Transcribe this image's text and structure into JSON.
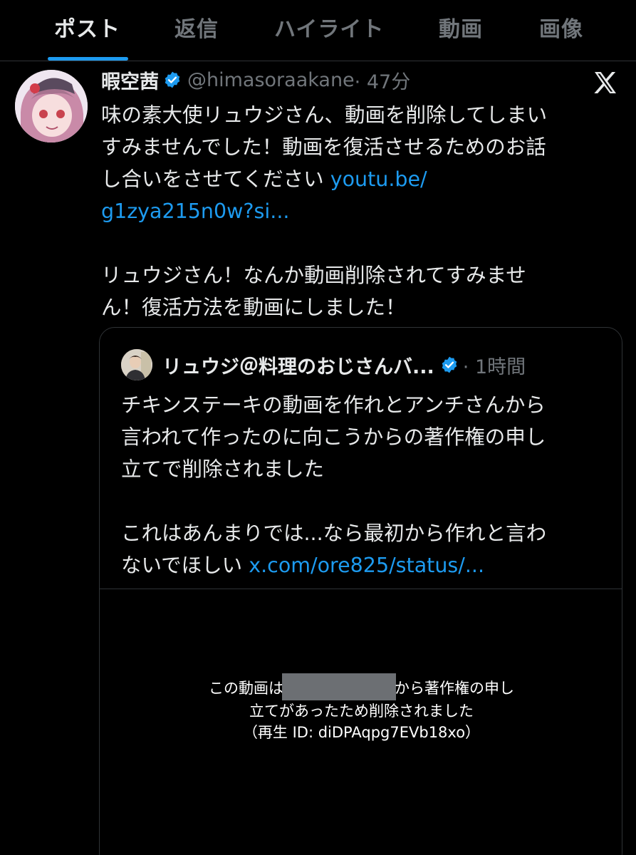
{
  "tabs": [
    {
      "label": "ポスト",
      "active": true
    },
    {
      "label": "返信",
      "active": false
    },
    {
      "label": "ハイライト",
      "active": false
    },
    {
      "label": "動画",
      "active": false
    },
    {
      "label": "画像",
      "active": false
    }
  ],
  "post": {
    "name": "暇空茜",
    "handle": "@himasoraakane",
    "time": "· 47分",
    "lines": [
      "味の素大使リュウジさん、動画を削除してしまい",
      "すみませんでした！動画を復活させるためのお話",
      "し合いをさせてください "
    ],
    "link_part1": "youtu.be/",
    "link_part2": "g1zya215n0w?si...",
    "lines2": [
      "リュウジさん！なんか動画削除されてすみませ",
      "ん！復活方法を動画にしました！"
    ]
  },
  "quote": {
    "name": "リュウジ＠料理のおじさんバ...",
    "time": "· 1時間",
    "lines": [
      "チキンステーキの動画を作れとアンチさんから",
      "言われて作ったのに向こうからの著作権の申し",
      "立てで削除されました",
      "これはあんまりでは...なら最初から作れと言わ",
      "ないでほしい "
    ],
    "link": "x.com/ore825/status/..."
  },
  "media": {
    "line1_a": "この動画は",
    "line1_b": "から著作権の申し",
    "line2": "立てがあったため削除されました",
    "line3": "（再生 ID: diDPAqpg7EVb18xo）"
  },
  "colors": {
    "background": "#000000",
    "text": "#e7e9ea",
    "muted": "#71767b",
    "accent": "#1d9bf0",
    "border": "#2f3336"
  },
  "icons": [
    "verified-badge-icon",
    "x-logo-icon"
  ]
}
